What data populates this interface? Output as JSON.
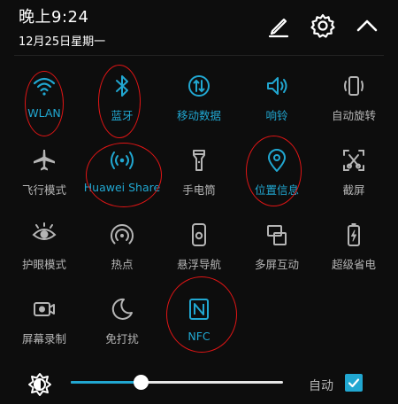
{
  "header": {
    "time": "晚上9:24",
    "date": "12月25日星期一"
  },
  "colors": {
    "accent": "#21a7d1",
    "inactive": "#b5b5b5",
    "annotation": "#e01515"
  },
  "tiles": [
    {
      "label": "WLAN",
      "icon": "wifi-icon",
      "active": true
    },
    {
      "label": "蓝牙",
      "icon": "bluetooth-icon",
      "active": true
    },
    {
      "label": "移动数据",
      "icon": "mobile-data-icon",
      "active": true
    },
    {
      "label": "响铃",
      "icon": "ringer-icon",
      "active": true
    },
    {
      "label": "自动旋转",
      "icon": "auto-rotate-icon",
      "active": false
    },
    {
      "label": "飞行模式",
      "icon": "airplane-icon",
      "active": false
    },
    {
      "label": "Huawei Share",
      "icon": "huawei-share-icon",
      "active": true
    },
    {
      "label": "手电筒",
      "icon": "flashlight-icon",
      "active": false
    },
    {
      "label": "位置信息",
      "icon": "location-icon",
      "active": true
    },
    {
      "label": "截屏",
      "icon": "screenshot-icon",
      "active": false
    },
    {
      "label": "护眼模式",
      "icon": "eye-comfort-icon",
      "active": false
    },
    {
      "label": "热点",
      "icon": "hotspot-icon",
      "active": false
    },
    {
      "label": "悬浮导航",
      "icon": "floating-nav-icon",
      "active": false
    },
    {
      "label": "多屏互动",
      "icon": "multi-screen-icon",
      "active": false
    },
    {
      "label": "超级省电",
      "icon": "power-saving-icon",
      "active": false
    },
    {
      "label": "屏幕录制",
      "icon": "screen-record-icon",
      "active": false
    },
    {
      "label": "免打扰",
      "icon": "do-not-disturb-icon",
      "active": false
    },
    {
      "label": "NFC",
      "icon": "nfc-icon",
      "active": true
    }
  ],
  "brightness": {
    "level": 0.33,
    "auto_label": "自动",
    "auto_checked": true
  }
}
